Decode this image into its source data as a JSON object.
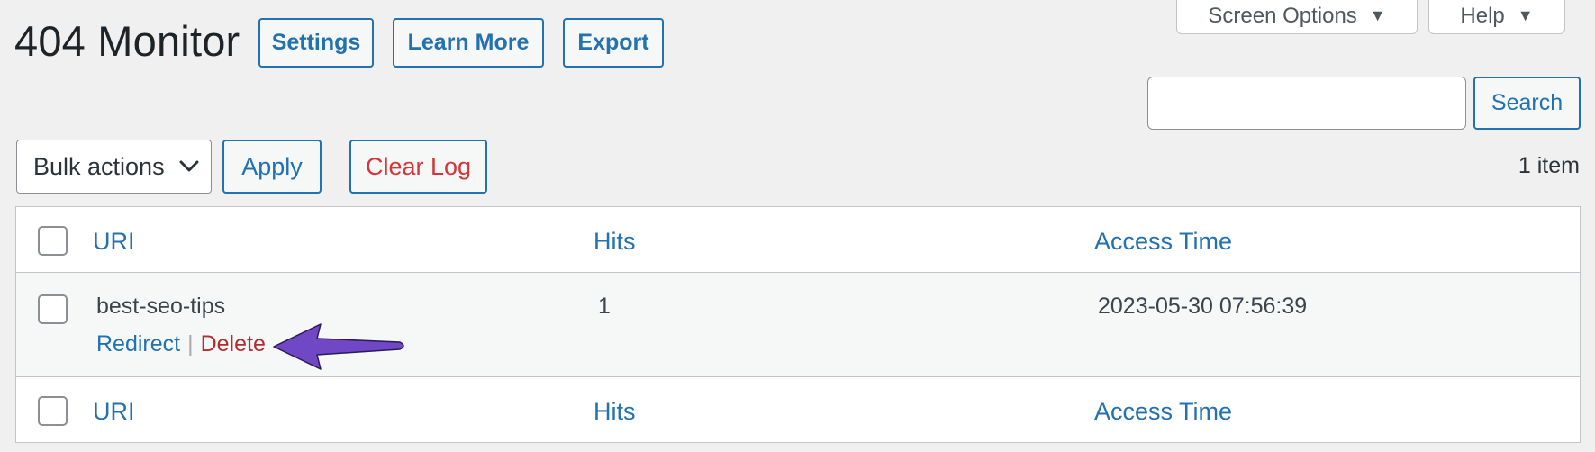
{
  "header": {
    "title": "404 Monitor",
    "buttons": {
      "settings": "Settings",
      "learn_more": "Learn More",
      "export": "Export"
    },
    "screen_options": "Screen Options",
    "help": "Help"
  },
  "search": {
    "value": "",
    "button": "Search"
  },
  "tablenav": {
    "bulk_actions": "Bulk actions",
    "apply": "Apply",
    "clear_log": "Clear Log",
    "item_count": "1 item"
  },
  "table": {
    "columns": {
      "uri": "URI",
      "hits": "Hits",
      "access_time": "Access Time"
    },
    "rows": [
      {
        "uri": "best-seo-tips",
        "hits": "1",
        "access_time": "2023-05-30 07:56:39",
        "actions": {
          "redirect": "Redirect",
          "separator": "|",
          "delete": "Delete"
        }
      }
    ]
  },
  "colors": {
    "accent": "#2271b1",
    "danger": "#d63638",
    "delete_link": "#b32d2e",
    "background": "#f0f0f1",
    "annotation_arrow": "#7047c4"
  }
}
